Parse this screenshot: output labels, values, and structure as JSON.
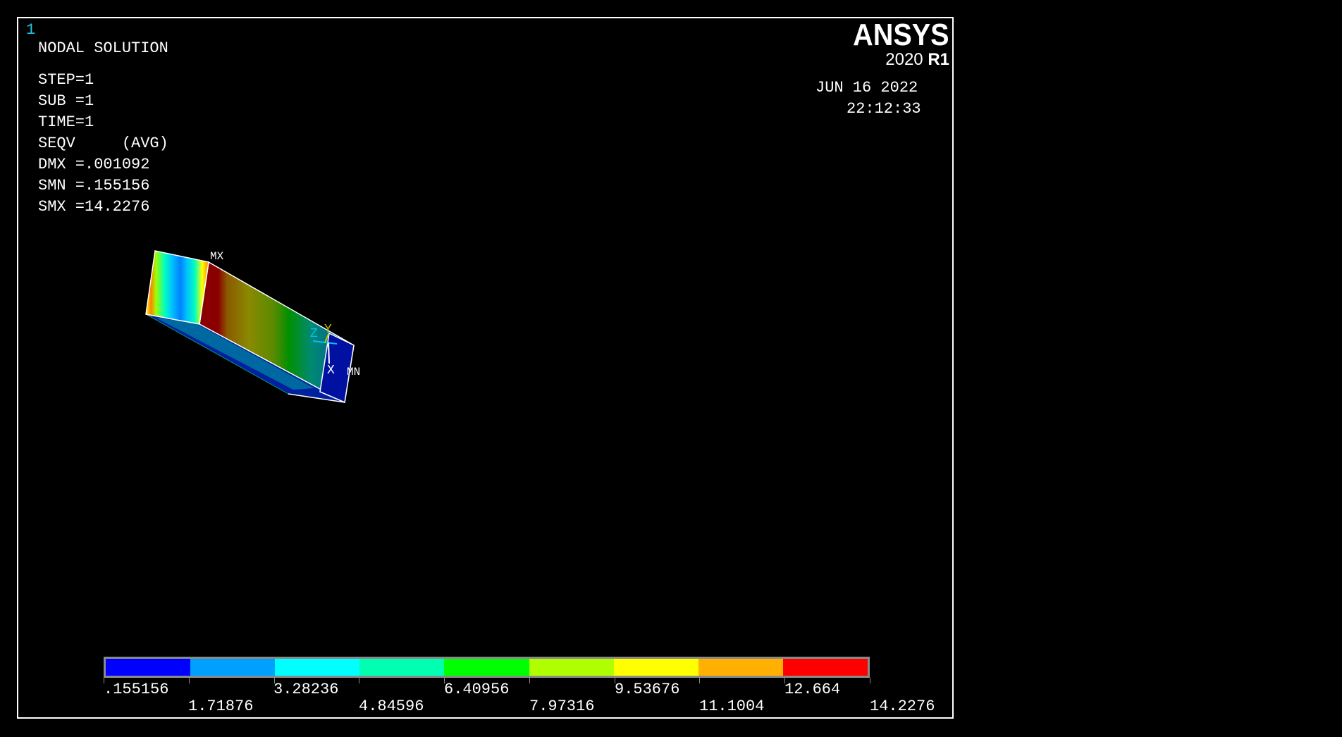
{
  "window_number": "1",
  "title": "NODAL SOLUTION",
  "info_lines": [
    "STEP=1",
    "SUB =1",
    "TIME=1",
    "SEQV     (AVG)",
    "DMX =.001092",
    "SMN =.155156",
    "SMX =14.2276"
  ],
  "logo": {
    "brand": "ANSYS",
    "version": "2020",
    "release": "R1"
  },
  "date": "JUN 16 2022",
  "time": "22:12:33",
  "markers": {
    "max": "MX",
    "min": "MN"
  },
  "triad": {
    "x": "X",
    "y": "Y",
    "z": "Z"
  },
  "colors": {
    "legend": [
      "#0000ff",
      "#00a0ff",
      "#00ffff",
      "#00ffb0",
      "#00ff00",
      "#b0ff00",
      "#ffff00",
      "#ffb000",
      "#ff0000"
    ],
    "window_number": "#22c5e6"
  },
  "legend_upper_labels": [
    ".155156",
    "3.28236",
    "6.40956",
    "9.53676",
    "12.664"
  ],
  "legend_lower_labels": [
    "1.71876",
    "4.84596",
    "7.97316",
    "11.1004",
    "14.2276"
  ]
}
